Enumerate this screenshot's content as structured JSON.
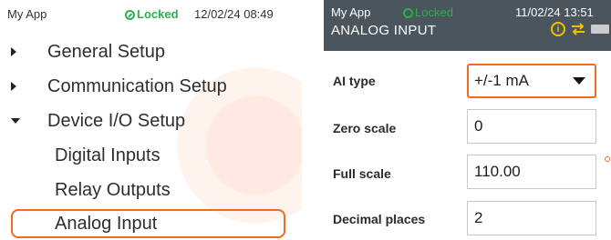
{
  "left": {
    "status": {
      "app": "My App",
      "lock": "Locked",
      "datetime": "12/02/24 08:49"
    },
    "menu": [
      {
        "label": "General Setup",
        "expanded": false
      },
      {
        "label": "Communication Setup",
        "expanded": false
      },
      {
        "label": "Device I/O Setup",
        "expanded": true
      },
      {
        "label": "Digital Inputs"
      },
      {
        "label": "Relay Outputs"
      },
      {
        "label": "Analog Input",
        "selected": true
      }
    ]
  },
  "right": {
    "status": {
      "app": "My App",
      "lock": "Locked",
      "datetime": "11/02/24 13:51"
    },
    "title": "ANALOG INPUT",
    "icons": [
      "info-icon",
      "swap-arrows-icon",
      "battery-icon"
    ],
    "fields": [
      {
        "label": "AI type",
        "value": "+/-1 mA",
        "type": "select",
        "focused": true
      },
      {
        "label": "Zero scale",
        "value": "0",
        "type": "input"
      },
      {
        "label": "Full scale",
        "value": "110.00",
        "type": "input"
      },
      {
        "label": "Decimal places",
        "value": "2",
        "type": "input"
      }
    ]
  },
  "colors": {
    "accent": "#f26b21",
    "locked": "#2bb04a",
    "header_bg": "#4a555d",
    "info": "#f5c000"
  }
}
